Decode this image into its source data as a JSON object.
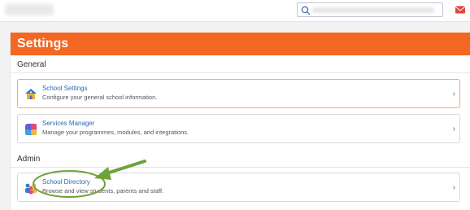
{
  "panel": {
    "title": "Settings"
  },
  "sections": {
    "general": {
      "label": "General"
    },
    "admin": {
      "label": "Admin"
    }
  },
  "cards": [
    {
      "title": "School Settings",
      "description": "Configure your general school information.",
      "icon": "school-building-icon"
    },
    {
      "title": "Services Manager",
      "description": "Manage your programmes, modules, and integrations.",
      "icon": "puzzle-app-icon"
    },
    {
      "title": "School Directory",
      "description": "Browse and view students, parents and staff.",
      "icon": "people-directory-icon"
    }
  ],
  "colors": {
    "header": "#f26722",
    "annotation": "#6ea33a",
    "link": "#2f6ab0"
  }
}
